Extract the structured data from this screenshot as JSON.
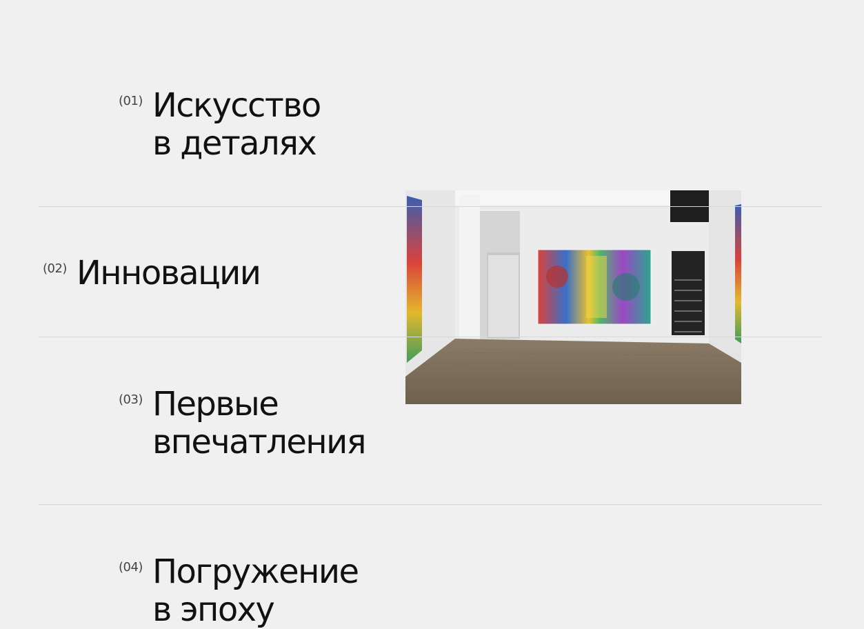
{
  "sections": [
    {
      "number": "(01)",
      "lines": [
        "Искусство",
        "в деталях"
      ]
    },
    {
      "number": "(02)",
      "lines": [
        "Инновации"
      ]
    },
    {
      "number": "(03)",
      "lines": [
        "Первые",
        "впечатления"
      ]
    },
    {
      "number": "(04)",
      "lines": [
        "Погружение",
        "в эпоху"
      ]
    }
  ],
  "colors": {
    "background": "#f0f0f0",
    "text": "#111111",
    "divider": "#d8d8d8"
  },
  "image": {
    "icon": "gallery-room-photo"
  }
}
